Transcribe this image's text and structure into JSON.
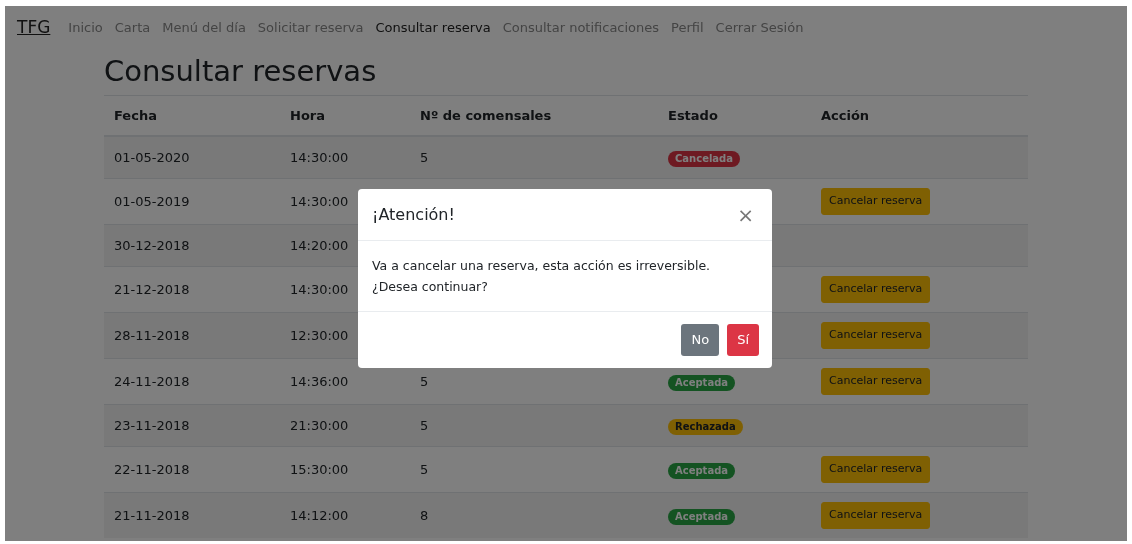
{
  "navbar": {
    "brand": "TFG",
    "items": [
      {
        "label": "Inicio",
        "selected": false
      },
      {
        "label": "Carta",
        "selected": false
      },
      {
        "label": "Menú del día",
        "selected": false
      },
      {
        "label": "Solicitar reserva",
        "selected": false
      },
      {
        "label": "Consultar reserva",
        "selected": true
      },
      {
        "label": "Consultar notificaciones",
        "selected": false
      },
      {
        "label": "Perfil",
        "selected": false
      },
      {
        "label": "Cerrar Sesión",
        "selected": false
      }
    ]
  },
  "heading": "Consultar reservas",
  "table": {
    "columns": [
      "Fecha",
      "Hora",
      "Nº de comensales",
      "Estado",
      "Acción"
    ],
    "rows": [
      {
        "fecha": "01-05-2020",
        "hora": "14:30:00",
        "comensales": "5",
        "estado": {
          "label": "Cancelada",
          "kind": "danger"
        }
      },
      {
        "fecha": "01-05-2019",
        "hora": "14:30:00",
        "action": "Cancelar reserva"
      },
      {
        "fecha": "30-12-2018",
        "hora": "14:20:00"
      },
      {
        "fecha": "21-12-2018",
        "hora": "14:30:00",
        "action": "Cancelar reserva"
      },
      {
        "fecha": "28-11-2018",
        "hora": "12:30:00",
        "action": "Cancelar reserva"
      },
      {
        "fecha": "24-11-2018",
        "hora": "14:36:00",
        "comensales": "5",
        "estado": {
          "label": "Aceptada",
          "kind": "success"
        },
        "action": "Cancelar reserva"
      },
      {
        "fecha": "23-11-2018",
        "hora": "21:30:00",
        "comensales": "5",
        "estado": {
          "label": "Rechazada",
          "kind": "warning"
        }
      },
      {
        "fecha": "22-11-2018",
        "hora": "15:30:00",
        "comensales": "5",
        "estado": {
          "label": "Aceptada",
          "kind": "success"
        },
        "action": "Cancelar reserva"
      },
      {
        "fecha": "21-11-2018",
        "hora": "14:12:00",
        "comensales": "8",
        "estado": {
          "label": "Aceptada",
          "kind": "success"
        },
        "action": "Cancelar reserva"
      }
    ]
  },
  "modal": {
    "title": "¡Atención!",
    "close": "×",
    "lines": [
      "Va a cancelar una reserva, esta acción es irreversible.",
      "¿Desea continuar?"
    ],
    "buttons": [
      {
        "label": "No",
        "kind": "secondary"
      },
      {
        "label": "Sí",
        "kind": "danger"
      }
    ]
  }
}
